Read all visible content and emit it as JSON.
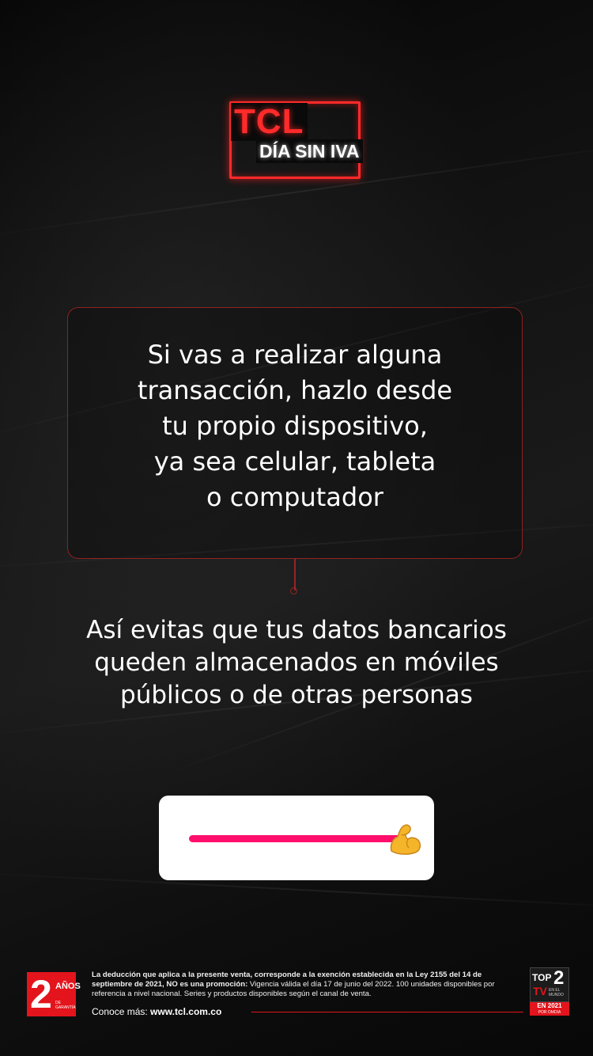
{
  "logo": {
    "brand": "TCL",
    "tagline": "DÍA SIN IVA"
  },
  "message": {
    "main_text": "Si vas a realizar alguna\ntransacción,  hazlo desde\ntu propio dispositivo,\nya sea celular, tableta\no computador",
    "secondary_text": "Así evitas que tus datos bancarios\nqueden almacenados en móviles\npúblicos o de otras personas"
  },
  "slider": {
    "value_fraction": 1.0,
    "thumb_icon": "flexed-biceps-emoji",
    "thumb_glyph": "💪",
    "track_color": "#ff0f6b"
  },
  "footer": {
    "warranty_badge": {
      "number": "2",
      "label": "AÑOS",
      "sublabel": "DE GARANTÍA"
    },
    "legal_bold": "La deducción que aplica a la presente venta, corresponde a la exención establecida en la Ley 2155 del 14 de septiembre de 2021, NO es una promoción:",
    "legal_rest": " Vigencia válida el día 17 de junio del 2022. 100 unidades disponibles por referencia a nivel nacional. Series y productos disponibles según el canal de venta.",
    "more_label": "Conoce más:",
    "more_url": "www.tcl.com.co",
    "top2_badge": {
      "top": "TOP",
      "two": "2",
      "tv": "TV",
      "mundo": "EN EL MUNDO",
      "year": "EN 2021",
      "source": "POR OMDIA"
    }
  },
  "colors": {
    "accent_red": "#e3141c",
    "neon_red": "#ff2b2b",
    "slider_pink": "#ff0f6b"
  }
}
